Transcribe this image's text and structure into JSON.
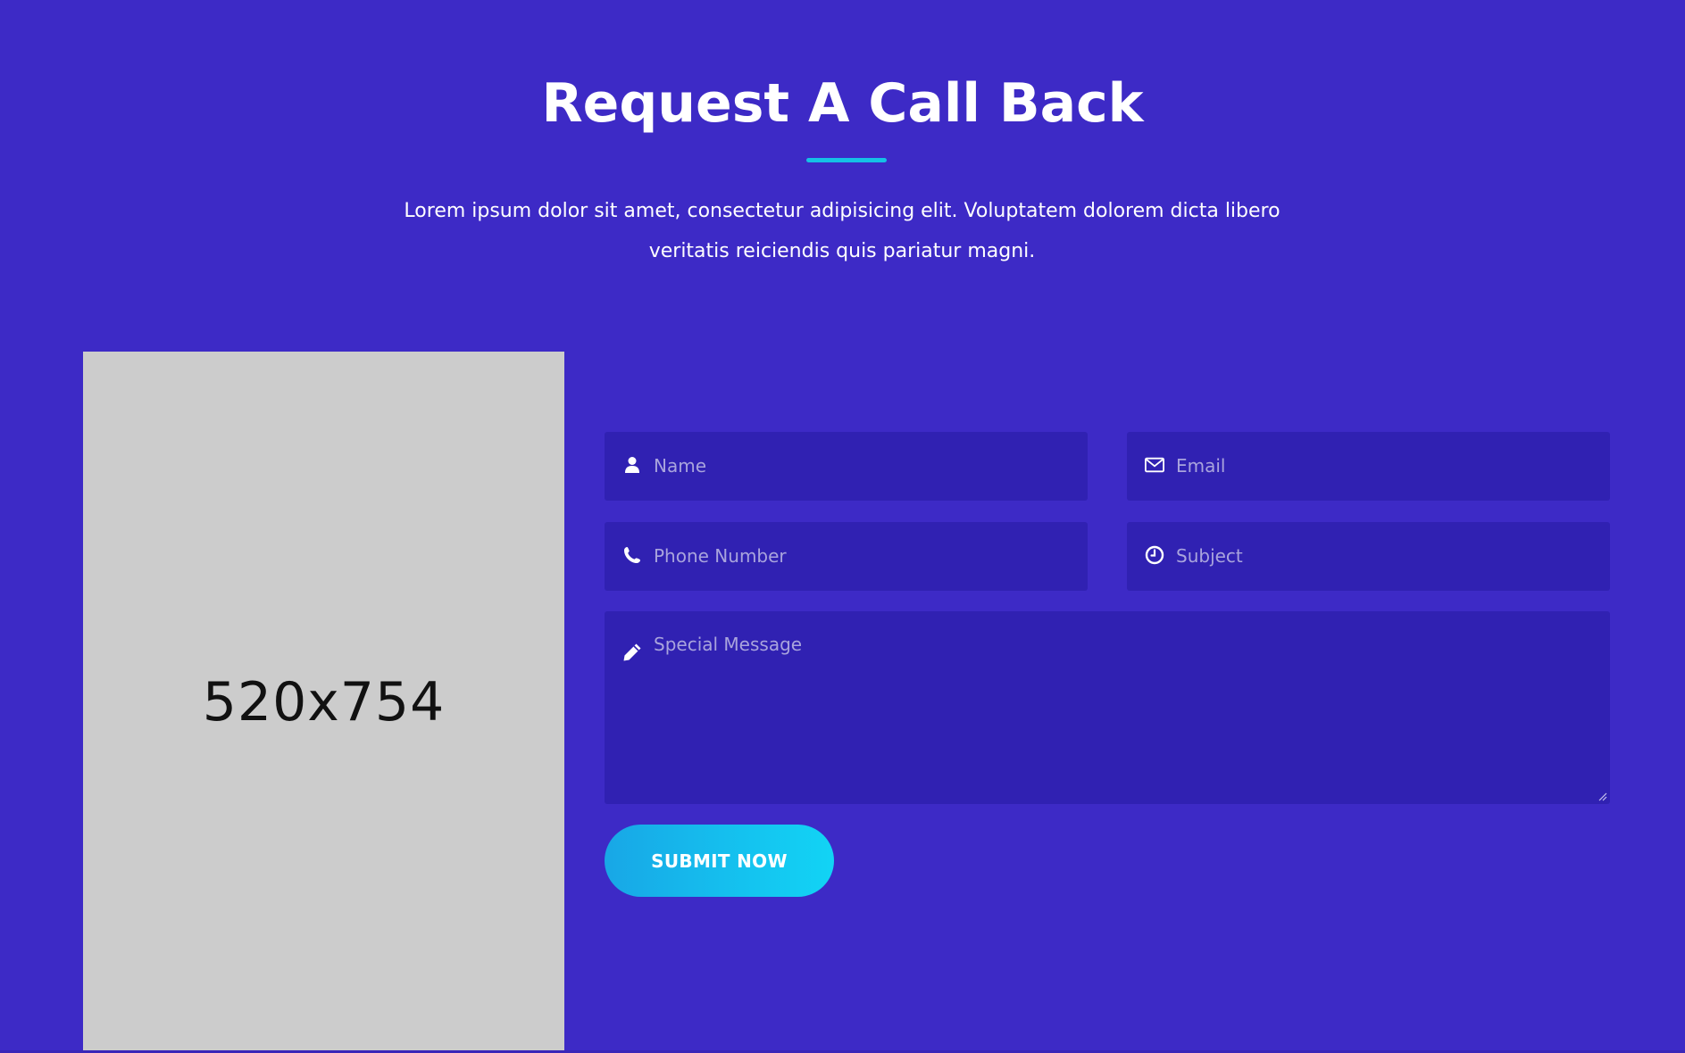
{
  "section": {
    "title": "Request A Call Back",
    "intro_line1": "Lorem ipsum dolor sit amet, consectetur adipisicing elit. Voluptatem dolorem dicta libero",
    "intro_line2": "veritatis reiciendis quis pariatur magni."
  },
  "image": {
    "label": "520x754"
  },
  "form": {
    "name_placeholder": "Name",
    "email_placeholder": "Email",
    "phone_placeholder": "Phone Number",
    "subject_placeholder": "Subject",
    "message_placeholder": "Special Message",
    "submit_label": "SUBMIT NOW"
  },
  "icons": {
    "name": "user-icon",
    "email": "envelope-icon",
    "phone": "phone-icon",
    "subject": "clock-icon",
    "message": "pencil-icon"
  },
  "colors": {
    "background": "#3d2ac6",
    "field_background": "#3021b2",
    "accent": "#15c1e6",
    "button_gradient_start": "#18a7e6",
    "button_gradient_end": "#12d4f5",
    "image_placeholder": "#cccccc"
  }
}
